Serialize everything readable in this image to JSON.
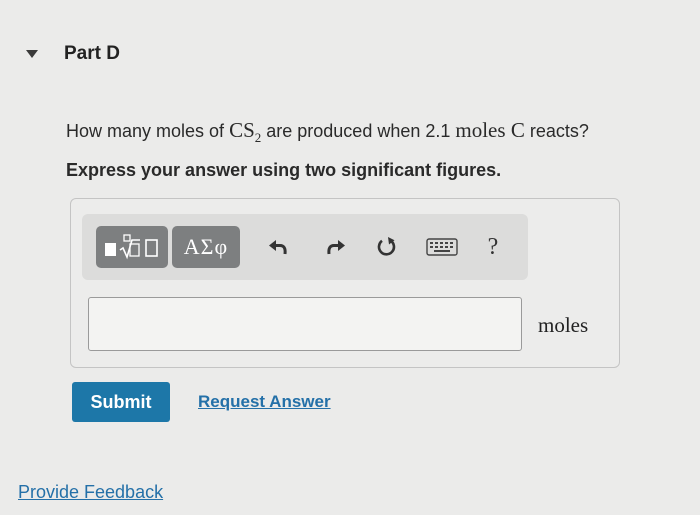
{
  "part": {
    "title": "Part D"
  },
  "question": {
    "prefix": "How many moles of ",
    "compound": "CS",
    "compound_subscript": "2",
    "middle": " are produced when 2.1 ",
    "unit": "moles",
    "space": " ",
    "element": "C",
    "suffix": " reacts?"
  },
  "instructions": "Express your answer using two significant figures.",
  "toolbar": {
    "greek_label": "ΑΣφ",
    "help_label": "?",
    "icons": [
      "templates-icon",
      "undo-icon",
      "redo-icon",
      "reset-icon",
      "keyboard-icon",
      "help-icon"
    ]
  },
  "answer": {
    "value": "",
    "placeholder": "",
    "unit_label": "moles"
  },
  "actions": {
    "submit_label": "Submit",
    "request_answer_label": "Request Answer"
  },
  "footer": {
    "feedback_label": "Provide Feedback"
  },
  "colors": {
    "submit_bg": "#1d77a8",
    "link": "#2470a8",
    "toolbar_button": "#7d7f80"
  }
}
